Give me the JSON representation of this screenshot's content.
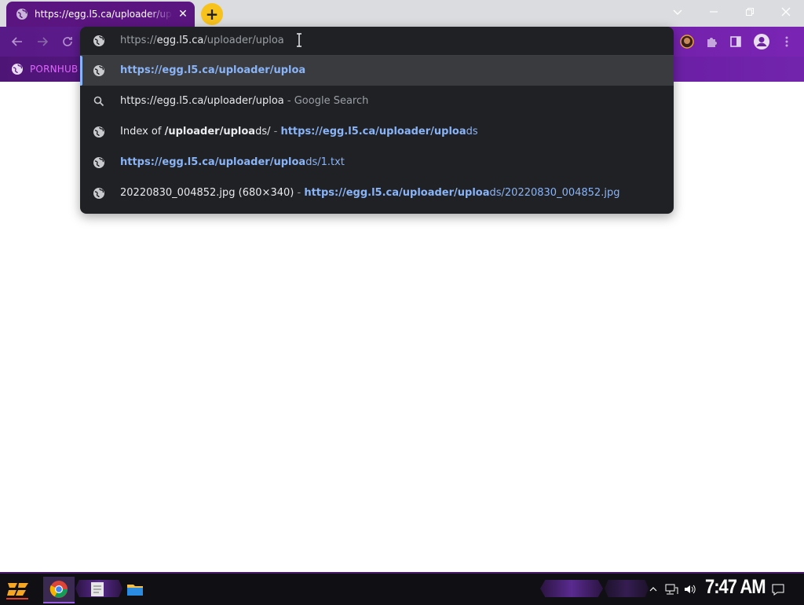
{
  "browser": {
    "tab": {
      "title": "https://egg.l5.ca/uploader/uploa",
      "close_label": "✕"
    },
    "new_tab_label": "+",
    "window_controls": {
      "tab_search": "⌄",
      "minimize": "—",
      "maximize": "❐",
      "close": "✕"
    },
    "bookmarks": [
      {
        "label": "PORNHUB"
      }
    ]
  },
  "omnibox": {
    "input": {
      "scheme": "https://",
      "host": "egg.l5.ca",
      "path": "/uploader/uploa"
    },
    "suggestions": [
      {
        "type": "url",
        "icon": "globe-icon",
        "selected": true,
        "parts": [
          {
            "text": "https://egg.l5.ca/uploader/uploa",
            "style": "url bold"
          }
        ]
      },
      {
        "type": "search",
        "icon": "search-icon",
        "selected": false,
        "parts": [
          {
            "text": "https://egg.l5.ca/uploader/uploa",
            "style": ""
          },
          {
            "text": " - Google Search",
            "style": "dim"
          }
        ]
      },
      {
        "type": "history",
        "icon": "globe-icon",
        "selected": false,
        "parts": [
          {
            "text": "Index of ",
            "style": ""
          },
          {
            "text": "/uploader/uploa",
            "style": "bold"
          },
          {
            "text": "ds/",
            "style": ""
          },
          {
            "text": " - ",
            "style": "dim"
          },
          {
            "text": "https://egg.l5.ca/uploader/uploa",
            "style": "url bold"
          },
          {
            "text": "ds",
            "style": "url"
          }
        ]
      },
      {
        "type": "history",
        "icon": "globe-icon",
        "selected": false,
        "parts": [
          {
            "text": "https://egg.l5.ca/uploader/uploa",
            "style": "url bold"
          },
          {
            "text": "ds/1.txt",
            "style": "url"
          }
        ]
      },
      {
        "type": "history",
        "icon": "globe-icon",
        "selected": false,
        "parts": [
          {
            "text": "20220830_004852.jpg (680×340)",
            "style": ""
          },
          {
            "text": " - ",
            "style": "dim"
          },
          {
            "text": "https://egg.l5.ca/uploader/uploa",
            "style": "url bold"
          },
          {
            "text": "ds/20220830_004852.jpg",
            "style": "url"
          }
        ]
      }
    ]
  },
  "taskbar": {
    "apps": [
      {
        "name": "chrome",
        "active": true
      },
      {
        "name": "notepad",
        "active": false
      },
      {
        "name": "file-explorer",
        "active": false
      }
    ],
    "clock": "7:47 AM"
  },
  "colors": {
    "tab_purple": "#5b1580",
    "toolbar_purple": "#6a1fa0",
    "omnibox_bg": "#202124",
    "url_blue": "#8ab4f8",
    "new_tab_yellow": "#f7c21c",
    "bookmark_pink": "#e066ff"
  }
}
